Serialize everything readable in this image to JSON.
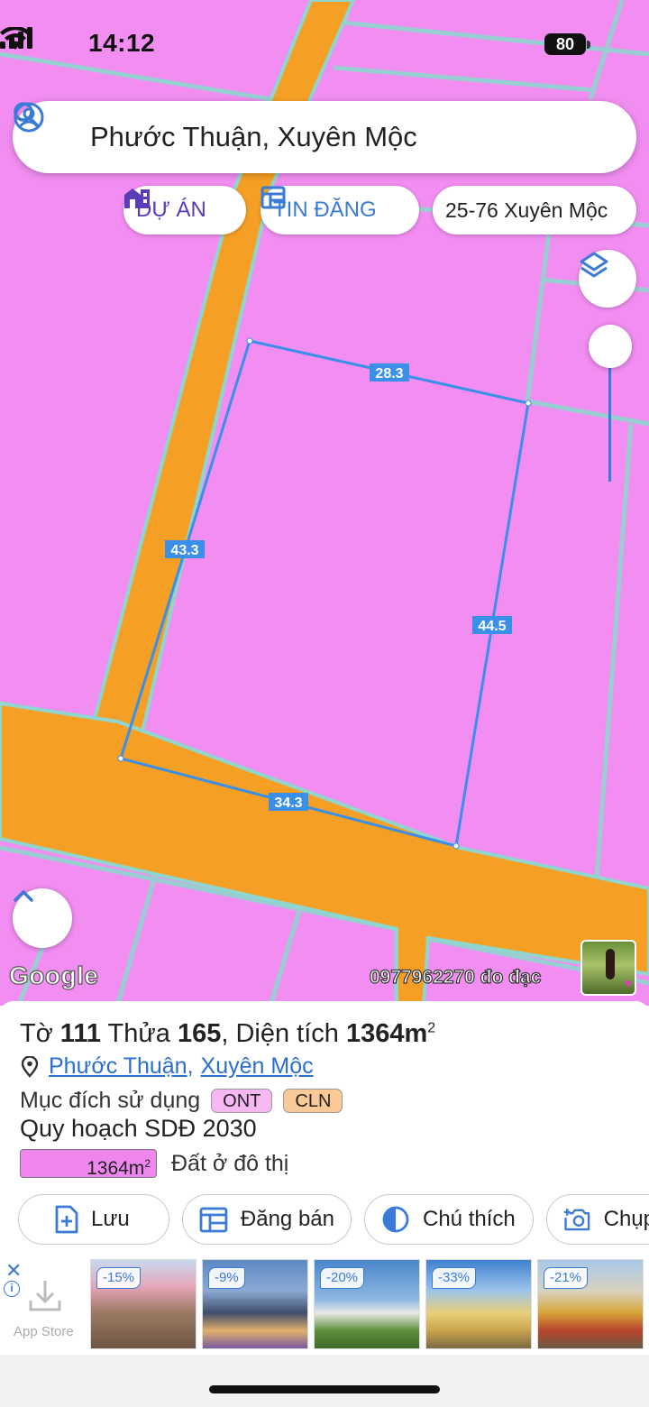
{
  "status_bar": {
    "time": "14:12",
    "battery": "80"
  },
  "search": {
    "text": "Phước Thuận, Xuyên Mộc"
  },
  "chips": {
    "du_an": "DỰ ÁN",
    "tin_dang": "TIN ĐĂNG",
    "location": "25-76 Xuyên Mộc"
  },
  "map": {
    "edge_labels": {
      "top": "28.3",
      "left": "43.3",
      "right": "44.5",
      "bottom": "34.3"
    },
    "google_logo": "Google",
    "watermark": "0977962270 đo đạc",
    "colors": {
      "residential": "#f28df2",
      "road": "#f5a024",
      "boundary": "#3a8fe8"
    }
  },
  "panel": {
    "title_prefix": "Tờ ",
    "sheet_no": "111",
    "title_mid": " Thửa ",
    "parcel_no": "165",
    "title_area_label": ", Diện tích ",
    "area_value": "1364m",
    "area_unit_sup": "2",
    "commune": "Phước Thuận",
    "district": "Xuyên Mộc",
    "purpose_label": "Mục đích sử dụng",
    "tags": [
      "ONT",
      "CLN"
    ],
    "plan_title": "Quy hoạch SDĐ 2030",
    "plan_area": "1364m",
    "plan_area_sup": "2",
    "plan_desc": "Đất ở đô thị"
  },
  "actions": {
    "save": "Lưu",
    "post_sale": "Đăng bán",
    "legend": "Chú thích",
    "capture": "Chụp"
  },
  "ad": {
    "store_label": "App Store",
    "close": "✕",
    "info": "i",
    "tiles": [
      {
        "discount": "-15%"
      },
      {
        "discount": "-9%"
      },
      {
        "discount": "-20%"
      },
      {
        "discount": "-33%"
      },
      {
        "discount": "-21%"
      }
    ]
  }
}
